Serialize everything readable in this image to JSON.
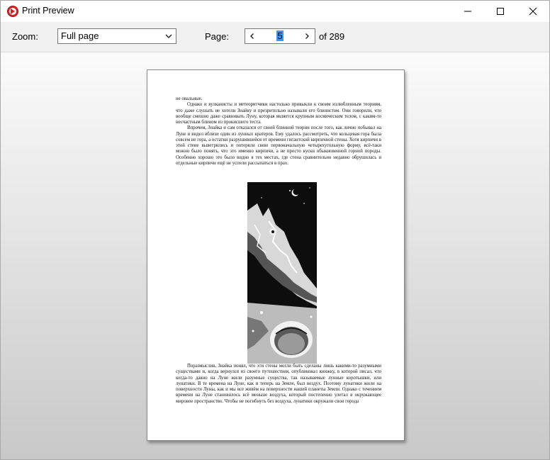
{
  "window": {
    "title": "Print Preview"
  },
  "toolbar": {
    "zoom_label": "Zoom:",
    "zoom_value": "Full page",
    "page_label": "Page:",
    "page_value": "5",
    "page_total": "of 289"
  },
  "document": {
    "top_paragraphs": [
      "не овальные.",
      "Однако и вулканисты и метеоритчики настолько привыкли к своим излюбленным теориям, что даже слушать не хотели Знайку и презрительно называли его блинистом. Они говорили, что вообще смешно даже сравнивать Луну, которая является крупным космическим телом, с каким-то несчастным блином из прокисшего теста.",
      "Впрочем, Знайка и сам отказался от своей блинной теории после того, как лично побывал на Луне и видел вблизи один из лунных кратеров. Ему удалось рассмотреть, что кольцевая гора была совсем не гора, а остатки разрушившейся от времени гигантской кирпичной стены. Хотя кирпичи в этой стене выветрились и потеряли свою первоначальную четырехугольную форму, всё-таки можно было понять, что это именно кирпичи, а не просто куски обыкновенной горной породы. Особенно хорошо это было видно в тех местах, где стена сравнительно недавно обрушилась и отдельные кирпичи ещё не успели рассыпаться в прах."
    ],
    "bottom_paragraphs": [
      "Поразмыслив, Знайка понял, что эти стены могли быть сделаны лишь какими-то разумными существами и, когда вернулся из своего путешествия, опубликовал книжку, в которой писал, что когда-то давно на Луне жили разумные существа, так называемые лунные коротышки, или лунатики. В те времена на Луне, как и теперь на Земле, был воздух. Поэтому лунатики жили на поверхности Луны, как и мы все живём на поверхности нашей планеты Земли. Однако с течением времени на Луне становилось всё меньше воздуха, который постепенно улетал в окружающее мировое пространство. Чтобы не погибнуть без воздуха, лунатики окружали свои города"
    ]
  },
  "icons": {
    "app": "app-logo-icon",
    "minimize": "minimize-icon",
    "maximize": "maximize-icon",
    "close": "close-icon",
    "dropdown": "chevron-down-icon",
    "prev": "chevron-left-icon",
    "next": "chevron-right-icon"
  },
  "colors": {
    "selection": "#3399ff",
    "app_icon": "#e02020"
  }
}
